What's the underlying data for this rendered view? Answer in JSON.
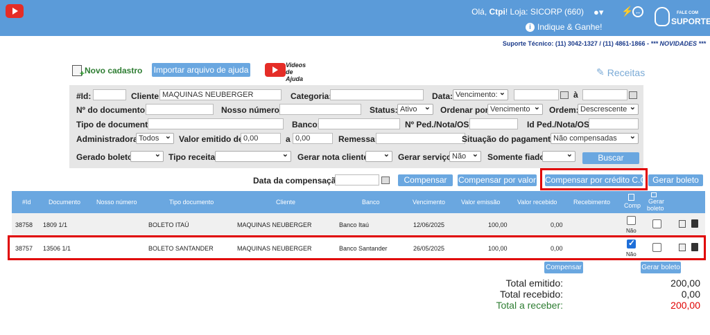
{
  "header": {
    "greeting_prefix": "Olá,",
    "user": "Ctpi",
    "greeting_suffix": "! Loja: SICORP (660)",
    "indique": "Indique & Ganhe!",
    "suporte_small": "FALE COM",
    "suporte_big": "SUPORTE",
    "phone_prefix": "Suporte Técnico: (11) 3042-1327 / (11) 4861-1866 -",
    "phone_news": "*** NOVIDADES ***"
  },
  "toolbar": {
    "novo": "Novo cadastro",
    "import": "Importar arquivo de ajuda",
    "videos_line1": "Videos",
    "videos_line2": "de Ajuda",
    "receitas": "Receitas"
  },
  "filters": {
    "id_label": "#Id:",
    "id_value": "",
    "cliente_label": "Cliente:",
    "cliente_value": "MAQUINAS NEUBERGER",
    "categoria_label": "Categoria:",
    "data_label": "Data:",
    "data_type": "Vencimento:",
    "a_label": "à",
    "documento_label": "Nº do documento:",
    "nosso_label": "Nosso número:",
    "status_label": "Status:",
    "status_value": "Ativo",
    "ordenar_label": "Ordenar por:",
    "ordenar_value": "Vencimento",
    "ordem_label": "Ordem:",
    "ordem_value": "Descrescente",
    "tipo_doc_label": "Tipo de documento:",
    "banco_label": "Banco:",
    "ped_label": "Nº Ped./Nota/OS:",
    "id_ped_label": "Id Ped./Nota/OS:",
    "admin_label": "Administradora:",
    "admin_value": "Todos",
    "valor_label": "Valor emitido de:",
    "valor_from": "0,00",
    "valor_a": "a",
    "valor_to": "0,00",
    "remessa_label": "Remessa:",
    "situacao_label": "Situação do pagamento:",
    "situacao_value": "Não compensadas",
    "gerado_label": "Gerado boleto:",
    "tipo_receita_label": "Tipo receita:",
    "nota_label": "Gerar nota cliente:",
    "servico_label": "Gerar serviço:",
    "servico_value": "Não",
    "fiado_label": "Somente fiado:",
    "buscar": "Buscar"
  },
  "compensacao": {
    "label": "Data da compensação:",
    "compensar": "Compensar",
    "compensar_valor": "Compensar por valor",
    "compensar_credito": "Compensar por crédito C.C",
    "gerar_boleto": "Gerar boleto"
  },
  "table": {
    "headers": {
      "id": "#Id",
      "documento": "Documento",
      "nosso": "Nosso número",
      "tipo": "Tipo documento",
      "cliente": "Cliente",
      "banco": "Banco",
      "vencimento": "Vencimento",
      "emissao": "Valor emissão",
      "recebido": "Valor recebido",
      "recebimento": "Recebimento",
      "comp": "Comp",
      "gerar1": "Gerar",
      "gerar2": "boleto"
    },
    "rows": [
      {
        "id": "38758",
        "doc": "1809 1/1",
        "tipo": "BOLETO ITAÚ",
        "cliente": "MAQUINAS NEUBERGER",
        "banco": "Banco Itaú",
        "venc": "12/06/2025",
        "emissao": "100,00",
        "recebido": "0,00",
        "nao": "Não"
      },
      {
        "id": "38757",
        "doc": "13506 1/1",
        "tipo": "BOLETO SANTANDER",
        "cliente": "MAQUINAS NEUBERGER",
        "banco": "Banco Santander",
        "venc": "26/05/2025",
        "emissao": "100,00",
        "recebido": "0,00",
        "nao": "Não"
      }
    ],
    "compensar": "Compensar",
    "gerar_boleto": "Gerar boleto"
  },
  "totals": {
    "emitido_label": "Total emitido:",
    "emitido_value": "200,00",
    "recebido_label": "Total recebido:",
    "recebido_value": "0,00",
    "receber_label": "Total a receber:",
    "receber_value": "200,00"
  },
  "colors": {
    "topbar": "#5b9bd9",
    "button": "#6aa7e0",
    "highlight": "#e00000",
    "receber_label": "#2e7d32",
    "receber_value": "#e00000"
  }
}
